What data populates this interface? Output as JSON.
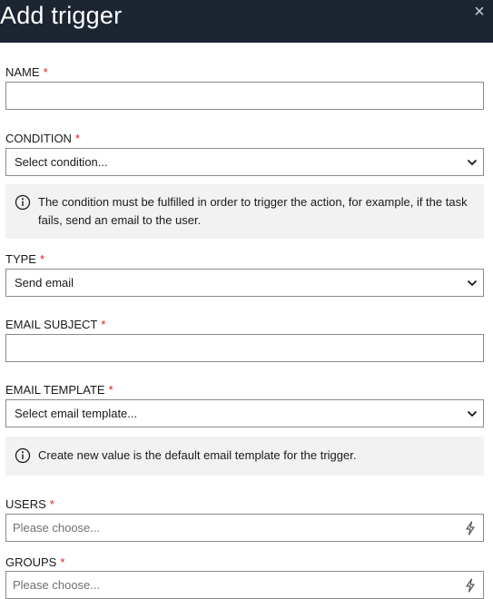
{
  "header": {
    "title": "Add trigger",
    "close_glyph": "×"
  },
  "required_mark": "*",
  "fields": {
    "name": {
      "label": "NAME",
      "value": ""
    },
    "condition": {
      "label": "CONDITION",
      "value": "Select condition..."
    },
    "condition_info": "The condition must be fulfilled in order to trigger the action, for example, if the task fails, send an email to the user.",
    "type": {
      "label": "TYPE",
      "value": "Send email"
    },
    "email_subject": {
      "label": "EMAIL SUBJECT",
      "value": ""
    },
    "email_template": {
      "label": "EMAIL TEMPLATE",
      "value": "Select email template..."
    },
    "email_template_info": "Create new value is the default email template for the trigger.",
    "users": {
      "label": "USERS",
      "placeholder": "Please choose..."
    },
    "groups": {
      "label": "GROUPS",
      "placeholder": "Please choose..."
    }
  },
  "icons": {
    "close": "close-icon",
    "dropdown": "chevron-down-icon",
    "info": "info-icon",
    "picker": "lightning-bolt-icon"
  },
  "colors": {
    "header_bg": "#1c2532",
    "required": "#e02020",
    "info_bg": "#f2f2f2",
    "border": "#8a8a8a"
  }
}
